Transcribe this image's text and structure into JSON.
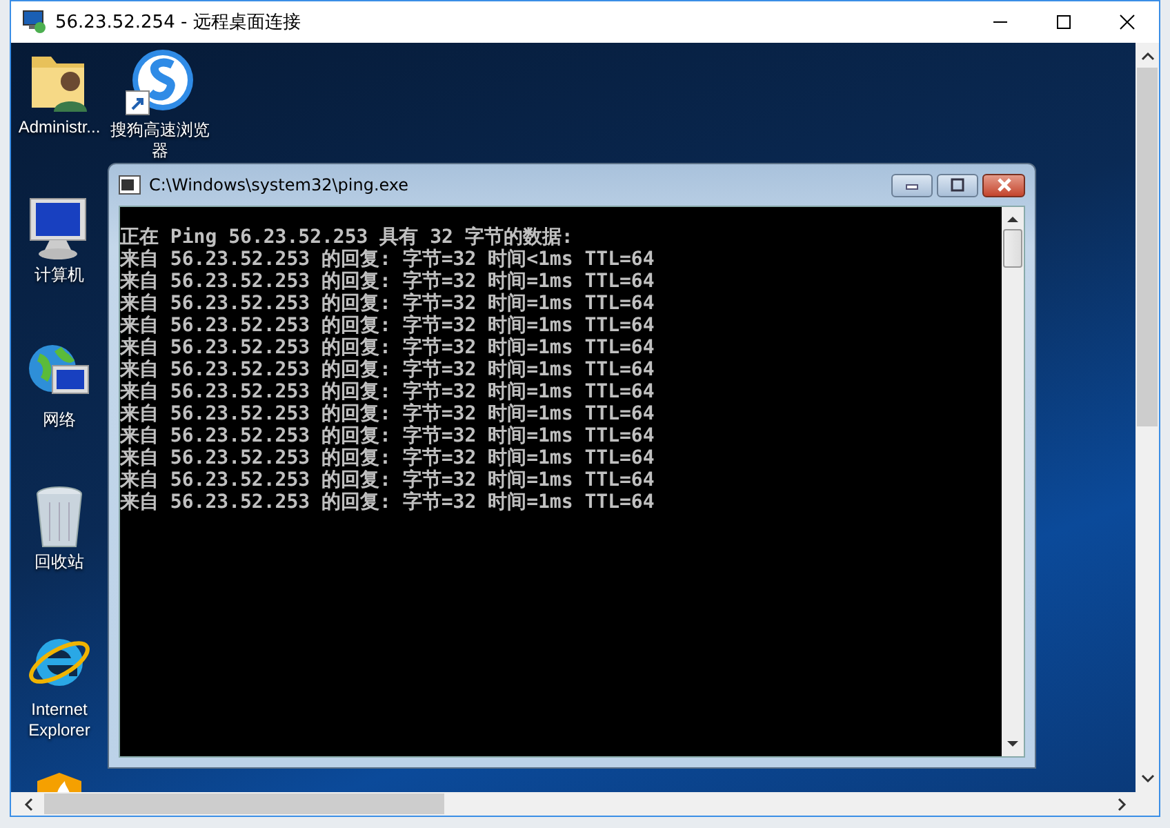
{
  "rdp_window": {
    "title": "56.23.52.254 - 远程桌面连接"
  },
  "desktop_icons": [
    {
      "kind": "user-folder",
      "label": "Administr..."
    },
    {
      "kind": "browser",
      "label": "搜狗高速浏览器"
    },
    {
      "kind": "computer",
      "label": "计算机"
    },
    {
      "kind": "network",
      "label": "网络"
    },
    {
      "kind": "recycle-bin",
      "label": "回收站"
    },
    {
      "kind": "ie",
      "label": "Internet Explorer"
    }
  ],
  "console": {
    "title": "C:\\Windows\\system32\\ping.exe",
    "lines": [
      "正在 Ping 56.23.52.253 具有 32 字节的数据:",
      "来自 56.23.52.253 的回复: 字节=32 时间<1ms TTL=64",
      "来自 56.23.52.253 的回复: 字节=32 时间=1ms TTL=64",
      "来自 56.23.52.253 的回复: 字节=32 时间=1ms TTL=64",
      "来自 56.23.52.253 的回复: 字节=32 时间=1ms TTL=64",
      "来自 56.23.52.253 的回复: 字节=32 时间=1ms TTL=64",
      "来自 56.23.52.253 的回复: 字节=32 时间=1ms TTL=64",
      "来自 56.23.52.253 的回复: 字节=32 时间=1ms TTL=64",
      "来自 56.23.52.253 的回复: 字节=32 时间=1ms TTL=64",
      "来自 56.23.52.253 的回复: 字节=32 时间=1ms TTL=64",
      "来自 56.23.52.253 的回复: 字节=32 时间=1ms TTL=64",
      "来自 56.23.52.253 的回复: 字节=32 时间=1ms TTL=64",
      "来自 56.23.52.253 的回复: 字节=32 时间=1ms TTL=64"
    ]
  }
}
